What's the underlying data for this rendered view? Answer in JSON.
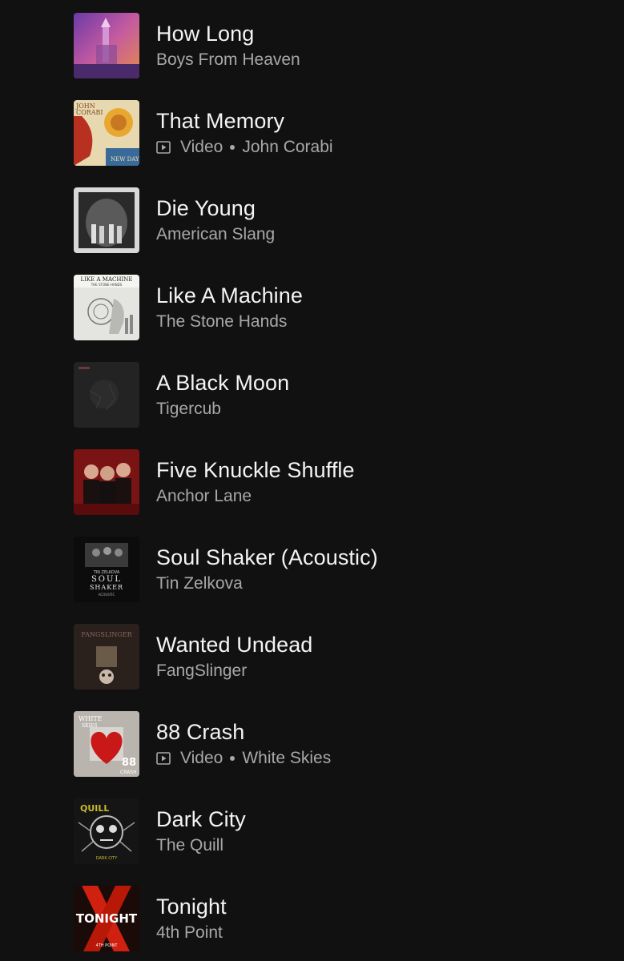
{
  "tracks": [
    {
      "title": "How Long",
      "artist": "Boys From Heaven",
      "is_video": false,
      "type_label": ""
    },
    {
      "title": "That Memory",
      "artist": "John Corabi",
      "is_video": true,
      "type_label": "Video"
    },
    {
      "title": "Die Young",
      "artist": "American Slang",
      "is_video": false,
      "type_label": ""
    },
    {
      "title": "Like A Machine",
      "artist": "The Stone Hands",
      "is_video": false,
      "type_label": ""
    },
    {
      "title": "A Black Moon",
      "artist": "Tigercub",
      "is_video": false,
      "type_label": ""
    },
    {
      "title": "Five Knuckle Shuffle",
      "artist": "Anchor Lane",
      "is_video": false,
      "type_label": ""
    },
    {
      "title": "Soul Shaker (Acoustic)",
      "artist": "Tin Zelkova",
      "is_video": false,
      "type_label": ""
    },
    {
      "title": "Wanted Undead",
      "artist": "FangSlinger",
      "is_video": false,
      "type_label": ""
    },
    {
      "title": "88 Crash",
      "artist": "White Skies",
      "is_video": true,
      "type_label": "Video"
    },
    {
      "title": "Dark City",
      "artist": "The Quill",
      "is_video": false,
      "type_label": ""
    },
    {
      "title": "Tonight",
      "artist": "4th Point",
      "is_video": false,
      "type_label": ""
    }
  ],
  "artwork_text": {
    "that_memory": [
      "JOHN",
      "CORABI",
      "NEW DAY"
    ],
    "like_a_machine": [
      "LIKE A MACHINE",
      "THE STONE HANDS"
    ],
    "soul_shaker": [
      "TIN ZELKOVA",
      "SOUL",
      "SHAKER",
      "ACOUSTIC"
    ],
    "wanted_undead": [
      "FANGSLINGER"
    ],
    "crash": [
      "WHITE",
      "SKIES",
      "88",
      "CRASH"
    ],
    "dark_city": [
      "QUILL",
      "DARK CITY"
    ],
    "tonight": [
      "TONIGHT",
      "4TH POINT"
    ]
  },
  "colors": {
    "background": "#111111",
    "title": "#f4f4f4",
    "subtitle": "#a8a8a8"
  }
}
